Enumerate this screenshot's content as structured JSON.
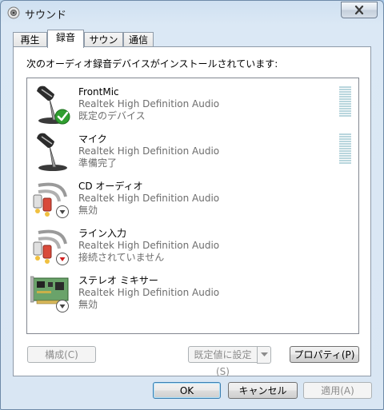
{
  "window": {
    "title": "サウンド"
  },
  "tabs": [
    {
      "label": "再生",
      "active": false
    },
    {
      "label": "録音",
      "active": true
    },
    {
      "label": "サウンド",
      "active": false
    },
    {
      "label": "通信",
      "active": false
    }
  ],
  "panel": {
    "instruction": "次のオーディオ録音デバイスがインストールされています:",
    "devices": [
      {
        "name": "FrontMic",
        "driver": "Realtek High Definition Audio",
        "status": "既定のデバイス",
        "icon": "microphone-icon",
        "badge": "default-check-icon",
        "level_meter": true
      },
      {
        "name": "マイク",
        "driver": "Realtek High Definition Audio",
        "status": "準備完了",
        "icon": "microphone-icon",
        "badge": "",
        "level_meter": true
      },
      {
        "name": "CD オーディオ",
        "driver": "Realtek High Definition Audio",
        "status": "無効",
        "icon": "rca-cable-icon",
        "badge": "disabled-arrow-icon",
        "level_meter": false
      },
      {
        "name": "ライン入力",
        "driver": "Realtek High Definition Audio",
        "status": "接続されていません",
        "icon": "rca-cable-icon",
        "badge": "unplugged-arrow-icon",
        "level_meter": false
      },
      {
        "name": "ステレオ ミキサー",
        "driver": "Realtek High Definition Audio",
        "status": "無効",
        "icon": "sound-card-icon",
        "badge": "disabled-arrow-icon",
        "level_meter": false
      }
    ],
    "configure_label": "構成(C)",
    "set_default_label": "既定値に設定(S)",
    "properties_label": "プロパティ(P)"
  },
  "footer": {
    "ok_label": "OK",
    "cancel_label": "キャンセル",
    "apply_label": "適用(A)"
  },
  "colors": {
    "accent": "#3c7fb1",
    "default_check": "#2f9e2f",
    "unplugged": "#d21e1e"
  }
}
